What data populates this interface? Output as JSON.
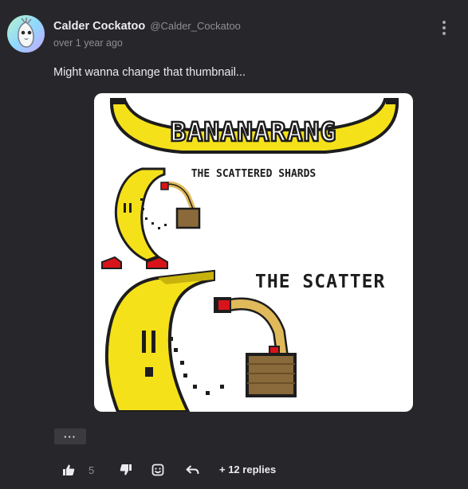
{
  "comment": {
    "author_name": "Calder Cockatoo",
    "author_handle": "@Calder_Cockatoo",
    "timestamp": "over 1 year ago",
    "text": "Might wanna change that thumbnail...",
    "more_label": "···"
  },
  "thumbnail": {
    "title": "BANANARANG",
    "subtitle": "THE SCATTERED SHARDS",
    "side_text": "THE SCATTER"
  },
  "actions": {
    "like_icon": "thumbs-up-icon",
    "like_count": "5",
    "dislike_icon": "thumbs-down-icon",
    "emoji_icon": "emoji-react-icon",
    "reply_icon": "reply-arrow-icon",
    "replies_label": "+ 12 replies"
  },
  "colors": {
    "background": "#27272b",
    "text": "#ececee",
    "muted": "#8d8d93",
    "banana_yellow": "#f5e11a"
  }
}
